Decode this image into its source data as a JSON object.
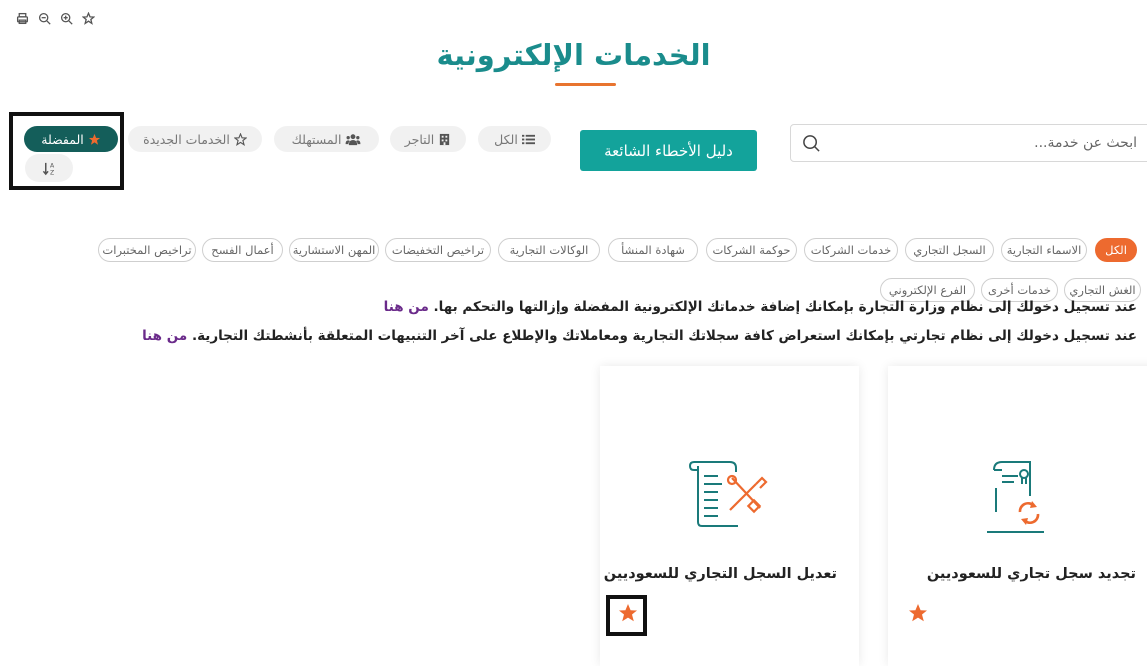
{
  "toolbar": {
    "icons": [
      "print-icon",
      "zoom-out-icon",
      "zoom-in-icon",
      "star-outline-icon"
    ]
  },
  "page_title": "الخدمات الإلكترونية",
  "search": {
    "placeholder": "ابحث عن خدمة..."
  },
  "errors_guide_label": "دليل الأخطاء الشائعة",
  "filters": {
    "all": "الكل",
    "merchant": "التاجر",
    "consumer": "المستهلك",
    "new_services": "الخدمات الجديدة",
    "favorites": "المفضلة"
  },
  "categories": [
    "الكل",
    "الاسماء التجارية",
    "السجل التجاري",
    "خدمات الشركات",
    "حوكمة الشركات",
    "شهادة المنشأ",
    "الوكالات التجارية",
    "تراخيص التخفيضات",
    "المهن الاستشارية",
    "أعمال الفسح",
    "تراخيص المختبرات",
    "الغش التجاري",
    "خدمات أخرى",
    "الفرع الإلكتروني"
  ],
  "info": {
    "line1_text": "عند تسجيل دخولك إلى نظام وزارة التجارة بإمكانك إضافة خدماتك الإلكترونية المفضلة وإزالتها والتحكم بها.",
    "line1_link": "من هنا",
    "line2_text": "عند تسجيل دخولك إلى نظام تجارتي بإمكانك استعراض كافة سجلاتك التجارية ومعاملاتك والإطلاع على آخر التنبيهات المتعلقة بأنشطتك التجارية.",
    "line2_link": "من هنا"
  },
  "cards": [
    {
      "title": "تجديد سجل تجاري للسعوديين",
      "icon": "renew-document-icon",
      "favorite": true
    },
    {
      "title": "تعديل السجل التجاري للسعوديين",
      "icon": "edit-document-tools-icon",
      "favorite": true
    }
  ],
  "colors": {
    "teal": "#13a39b",
    "heading_teal": "#1a8c8c",
    "dark_teal": "#145e5a",
    "orange": "#ed6a2f",
    "link_purple": "#6a2a8a"
  }
}
